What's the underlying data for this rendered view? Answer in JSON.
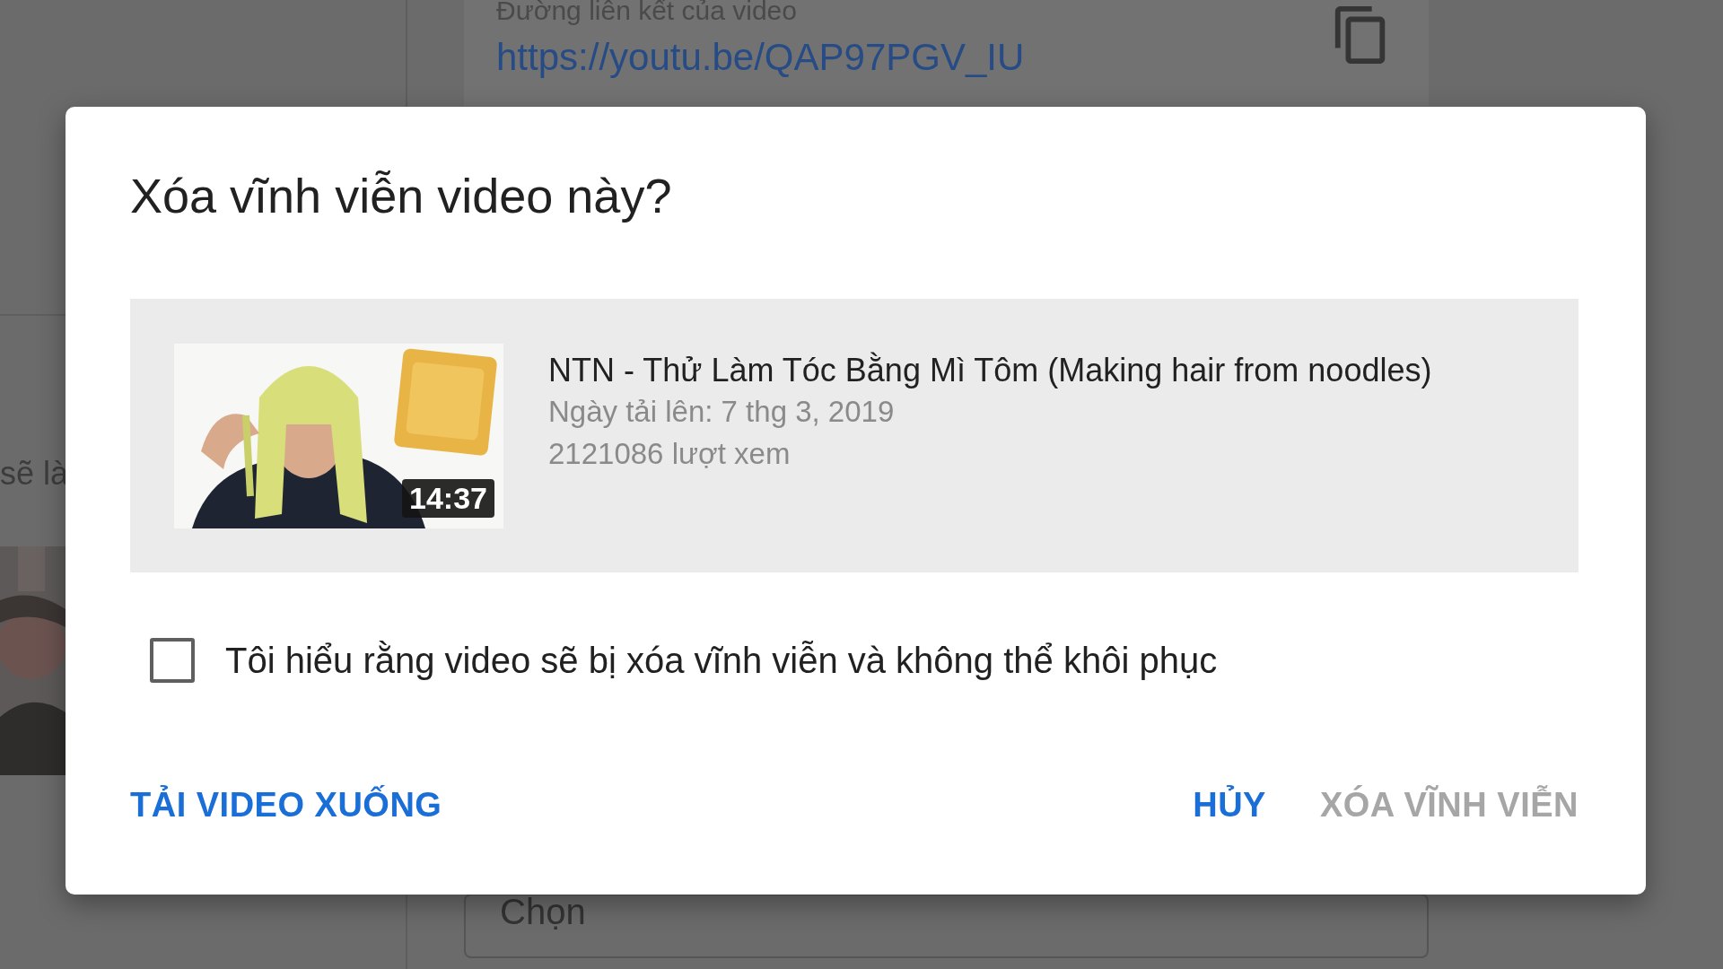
{
  "background": {
    "link_label": "Đường liên kết của video",
    "link": "https://youtu.be/QAP97PGV_IU",
    "side_text": "sẽ là",
    "select_placeholder": "Chọn"
  },
  "dialog": {
    "title": "Xóa vĩnh viễn video này?",
    "video": {
      "title": "NTN - Thử Làm Tóc Bằng Mì Tôm (Making hair from noodles)",
      "upload_date": "Ngày tải lên: 7 thg 3, 2019",
      "views": "2121086 lượt xem",
      "duration": "14:37"
    },
    "confirm": {
      "label": "Tôi hiểu rằng video sẽ bị xóa vĩnh viễn và không thể khôi phục",
      "checked": false
    },
    "buttons": [
      {
        "label": "TẢI VIDEO XUỐNG",
        "kind": "secondary",
        "disabled": false
      },
      {
        "label": "HỦY",
        "kind": "action",
        "disabled": false
      },
      {
        "label": "XÓA VĨNH VIỄN",
        "kind": "action",
        "disabled": true
      }
    ]
  }
}
